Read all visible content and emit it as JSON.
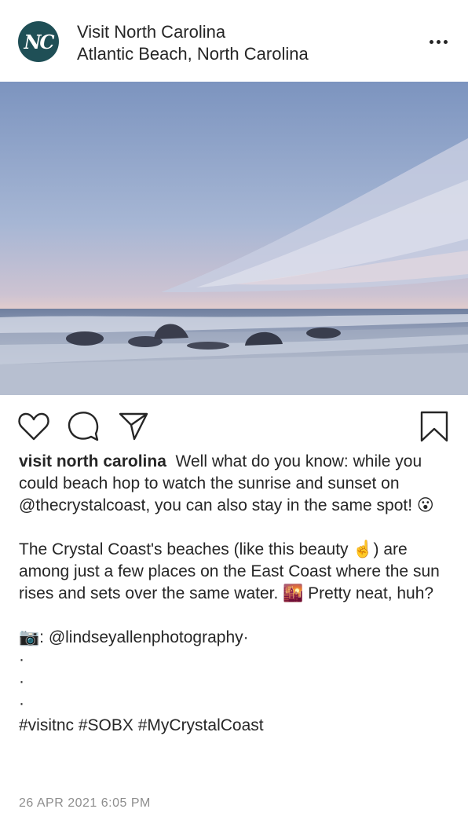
{
  "post": {
    "account": {
      "name": "Visit North Carolina",
      "location": "Atlantic Beach, North Carolina",
      "avatar_text": "NC",
      "avatar_color": "#1f4f56"
    },
    "photo": {
      "icon": "beach-sunset-photo"
    },
    "actions": {
      "like_icon": "heart-icon",
      "comment_icon": "comment-icon",
      "share_icon": "send-icon",
      "save_icon": "bookmark-icon"
    },
    "caption": {
      "username": "visit north carolina",
      "text": "Well what do you know: while you could beach hop to watch the sunrise and sunset on @thecrystalcoast, you can also stay in the same spot! 😮\n\nThe Crystal Coast's beaches (like this beauty ☝️) are among just a few places on the East Coast where the sun rises and sets over the same water. 🌇 Pretty neat, huh?\n\n📷: @lindseyallenphotography·\n·\n·\n·\n#visitnc #SOBX #MyCrystalCoast"
    },
    "timestamp": "26 APR 2021 6:05 PM"
  }
}
